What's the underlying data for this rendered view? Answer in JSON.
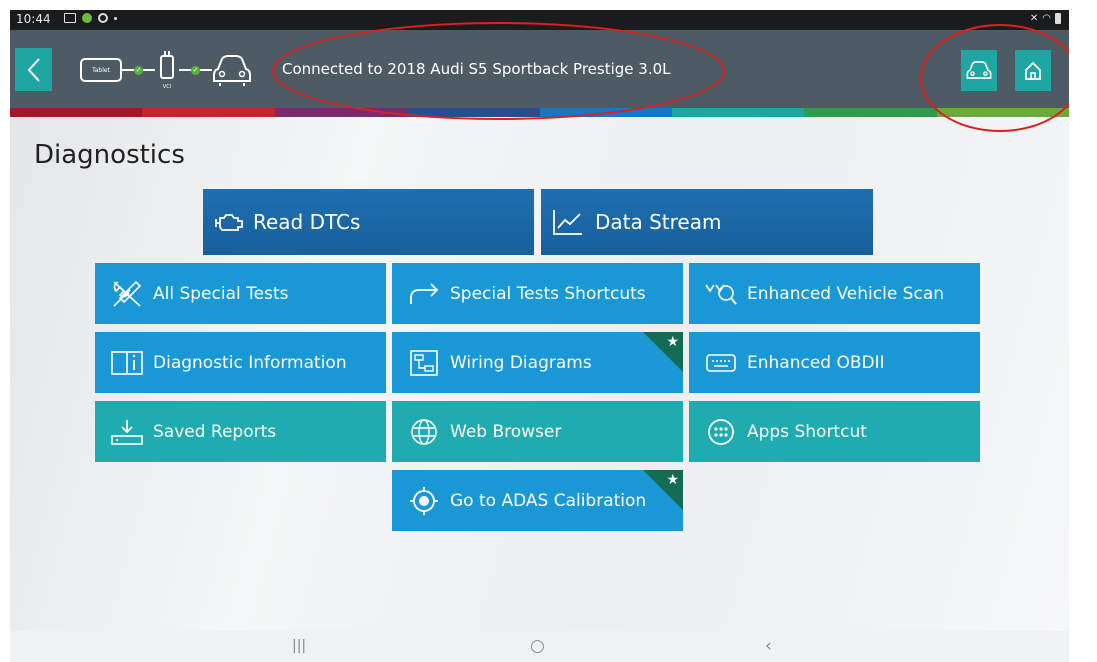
{
  "statusbar": {
    "time": "10:44"
  },
  "header": {
    "tablet_label": "Tablet",
    "vci_label": "VCI",
    "connection_text": "Connected to 2018 Audi S5 Sportback Prestige 3.0L"
  },
  "page_title": "Diagnostics",
  "primary": {
    "read_dtcs": "Read DTCs",
    "data_stream": "Data Stream"
  },
  "tiles": {
    "all_special_tests": "All Special Tests",
    "special_tests_shortcuts": "Special Tests Shortcuts",
    "enhanced_vehicle_scan": "Enhanced Vehicle Scan",
    "diagnostic_information": "Diagnostic Information",
    "wiring_diagrams": "Wiring Diagrams",
    "enhanced_obdii": "Enhanced OBDII",
    "saved_reports": "Saved Reports",
    "web_browser": "Web Browser",
    "apps_shortcut": "Apps Shortcut",
    "adas_calibration": "Go to ADAS Calibration"
  },
  "colors": {
    "header_bg": "#4f5b64",
    "accent_teal": "#1fa6a3",
    "tile_blue": "#1a98d6",
    "tile_teal": "#1fabb0",
    "primary_blue": "#1f6fb0",
    "badge_green": "#146b54",
    "annotation_red": "#e01e1e"
  },
  "icons": [
    "back-chevron-icon",
    "car-icon",
    "home-icon",
    "engine-icon",
    "chart-icon",
    "tools-icon",
    "redirect-arrow-icon",
    "scan-icon",
    "book-icon",
    "wiring-icon",
    "keyboard-icon",
    "download-icon",
    "globe-icon",
    "apps-icon",
    "target-icon",
    "star-icon"
  ]
}
